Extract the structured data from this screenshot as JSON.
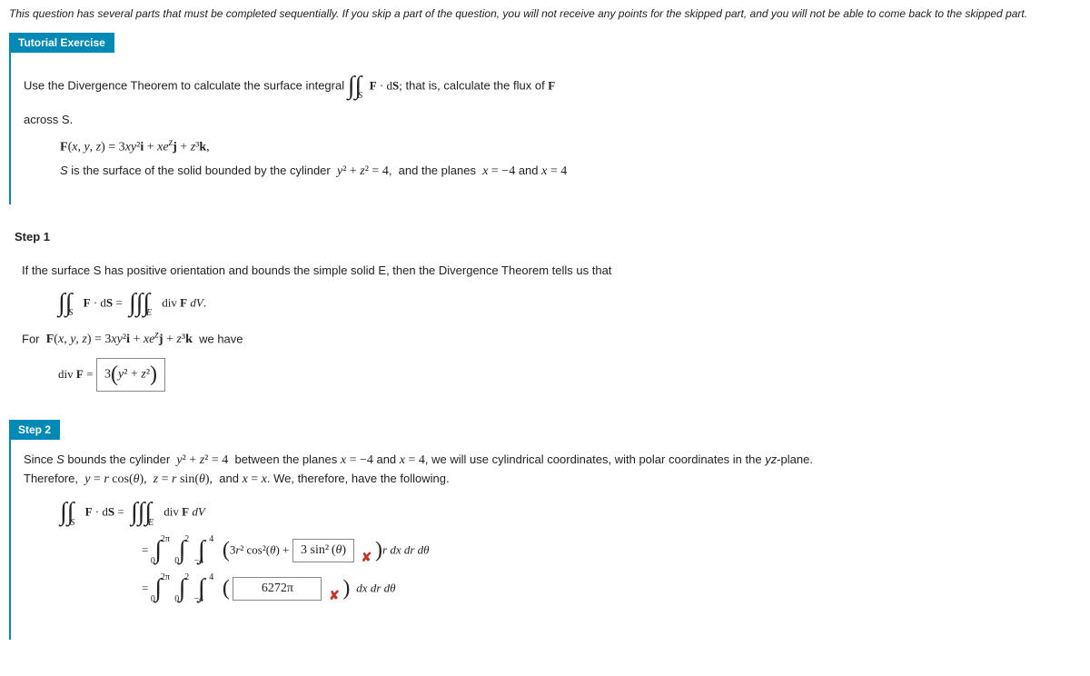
{
  "instructions": "This question has several parts that must be completed sequentially. If you skip a part of the question, you will not receive any points for the skipped part, and you will not be able to come back to the skipped part.",
  "tutorial": {
    "header": "Tutorial Exercise",
    "line1a": "Use the Divergence Theorem to calculate the surface integral ",
    "line1b": " that is, calculate the flux of ",
    "across": "across S.",
    "f_def": "F(x, y, z) = 3xy²i + xe^z j + z³k,",
    "s_def": "S is the surface of the solid bounded by the cylinder  y² + z² = 4,  and the planes  x = −4 and x = 4"
  },
  "step1": {
    "label": "Step 1",
    "text1": "If the surface S has positive orientation and bounds the simple solid E, then the Divergence Theorem tells us that",
    "text2": "For  F(x, y, z) = 3xy²i + xe^z j + z³k  we have",
    "divF_label": "div F =",
    "answer": "3(y² + z²)"
  },
  "step2": {
    "label": "Step 2",
    "text1": "Since S bounds the cylinder  y² + z² = 4  between the planes x = −4 and x = 4, we will use cylindrical coordinates, with polar coordinates in the yz-plane. Therefore,  y = r cos(θ),  z = r sin(θ),  and x = x. We, therefore, have the following.",
    "integrand_prefix": "3r² cos²(θ) +",
    "answer1": "3 sin²(θ)",
    "tail1": "r dx dr dθ",
    "answer2": "6272π",
    "tail2": "dx dr dθ",
    "limits": {
      "theta_lo": "0",
      "theta_hi": "2π",
      "r_lo": "0",
      "r_hi": "2",
      "x_lo": "−4",
      "x_hi": "4"
    }
  },
  "math": {
    "FdS": "F · dS",
    "FdS_eq": "F · dS =",
    "divFdV": "div F dV.",
    "divFdV2": "div F dV",
    "F": "F",
    "semicolon": ";"
  }
}
